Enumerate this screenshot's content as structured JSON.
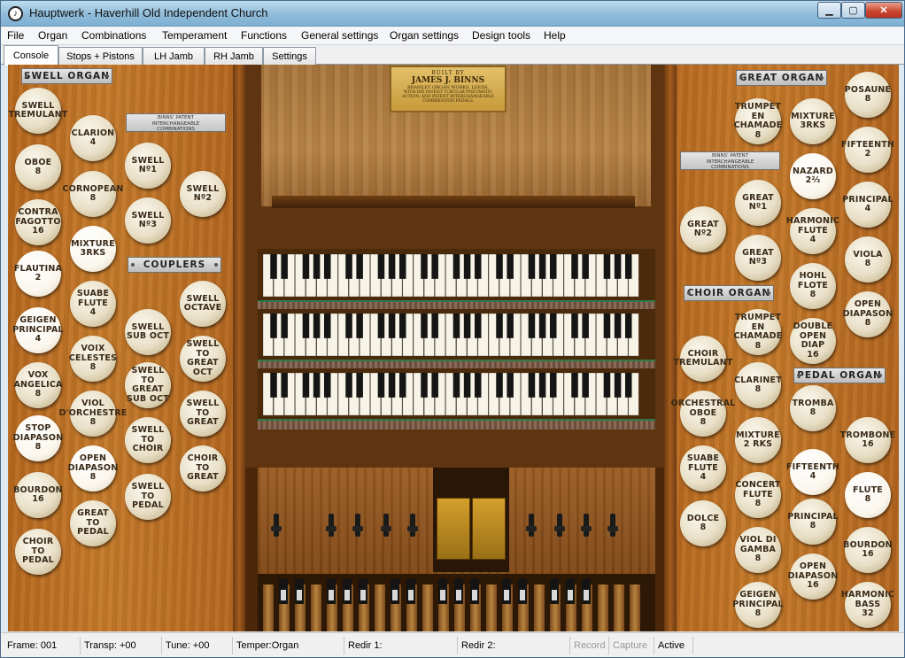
{
  "window": {
    "title": "Hauptwerk - Haverhill Old Independent Church",
    "controls": {
      "minimize": "▁",
      "maximize": "▢",
      "close": "✕"
    }
  },
  "menu": [
    "File",
    "Organ",
    "Combinations",
    "Temperament",
    "Functions",
    "General settings",
    "Organ settings",
    "Design tools",
    "Help"
  ],
  "tabs": [
    "Console",
    "Stops + Pistons",
    "LH Jamb",
    "RH Jamb",
    "Settings"
  ],
  "active_tab": "Console",
  "builder_plate": {
    "line1": "BUILT BY",
    "line2": "JAMES J. BINNS",
    "line3": "BRAMLEY ORGAN WORKS, LEEDS.",
    "line4": "WITH HIS PATENT TUBULAR PNEUMATIC\nACTION, AND PATENT INTERCHANGEABLE\nCOMBINATION PEDALS."
  },
  "left_jamb": {
    "plates": {
      "swell_organ": "SWELL ORGAN",
      "couplers": "COUPLERS"
    },
    "patent": "BINNS' PATENT\nINTERCHANGEABLE\nCOMBINATIONS",
    "stops": [
      "SWELL\nTREMULANT",
      "OBOE\n8",
      "CONTRA\nFAGOTTO\n16",
      "FLAUTINA\n2",
      "GEIGEN\nPRINCIPAL\n4",
      "VOX\nANGELICA\n8",
      "STOP\nDIAPASON\n8",
      "BOURDON\n16",
      "CHOIR\nTO\nPEDAL",
      "CLARION\n4",
      "CORNOPEAN\n8",
      "MIXTURE\n3RKS",
      "SUABE\nFLUTE\n4",
      "VOIX\nCELESTES\n8",
      "VIOL\nD'ORCHESTRE\n8",
      "OPEN\nDIAPASON\n8",
      "GREAT\nTO\nPEDAL",
      "SWELL\nNº1",
      "SWELL\nNº3",
      "SWELL\nSUB OCT",
      "SWELL\nTO GREAT\nSUB OCT",
      "SWELL\nTO\nCHOIR",
      "SWELL\nTO\nPEDAL",
      "SWELL\nNº2",
      "SWELL\nOCTAVE",
      "SWELL\nTO GREAT\nOCT",
      "SWELL\nTO\nGREAT",
      "CHOIR\nTO\nGREAT"
    ]
  },
  "right_jamb": {
    "plates": {
      "great_organ": "GREAT ORGAN",
      "choir_organ": "CHOIR ORGAN",
      "pedal_organ": "PEDAL ORGAN"
    },
    "patent": "BINNS' PATENT\nINTERCHANGEABLE\nCOMBINATIONS",
    "stops": [
      "GREAT\nNº2",
      "CHOIR\nTREMULANT",
      "ORCHESTRAL\nOBOE\n8",
      "SUABE\nFLUTE\n4",
      "DOLCE\n8",
      "TRUMPET\nEN\nCHAMADE\n8",
      "GREAT\nNº1",
      "GREAT\nNº3",
      "TRUMPET\nEN\nCHAMADE\n8",
      "CLARINET\n8",
      "MIXTURE\n2 RKS",
      "CONCERT\nFLUTE\n8",
      "VIOL DI\nGAMBA\n8",
      "GEIGEN\nPRINCIPAL\n8",
      "MIXTURE\n3RKS",
      "NAZARD\n2⅔",
      "HARMONIC\nFLUTE\n4",
      "HOHL\nFLOTE\n8",
      "DOUBLE\nOPEN DIAP\n16",
      "TROMBA\n8",
      "FIFTEENTH\n4",
      "PRINCIPAL\n8",
      "OPEN\nDIAPASON\n16",
      "POSAUNE\n8",
      "FIFTEENTH\n2",
      "PRINCIPAL\n4",
      "VIOLA\n8",
      "OPEN\nDIAPASON\n8",
      "TROMBONE\n16",
      "FLUTE\n8",
      "BOURDON\n16",
      "HARMONIC\nBASS\n32"
    ]
  },
  "status": {
    "frame": "Frame: 001",
    "transp": "Transp: +00",
    "tune": "Tune: +00",
    "temper": "Temper:Organ",
    "redir1": "Redir 1:",
    "redir2": "Redir 2:",
    "record": "Record",
    "capture": "Capture",
    "active": "Active"
  }
}
